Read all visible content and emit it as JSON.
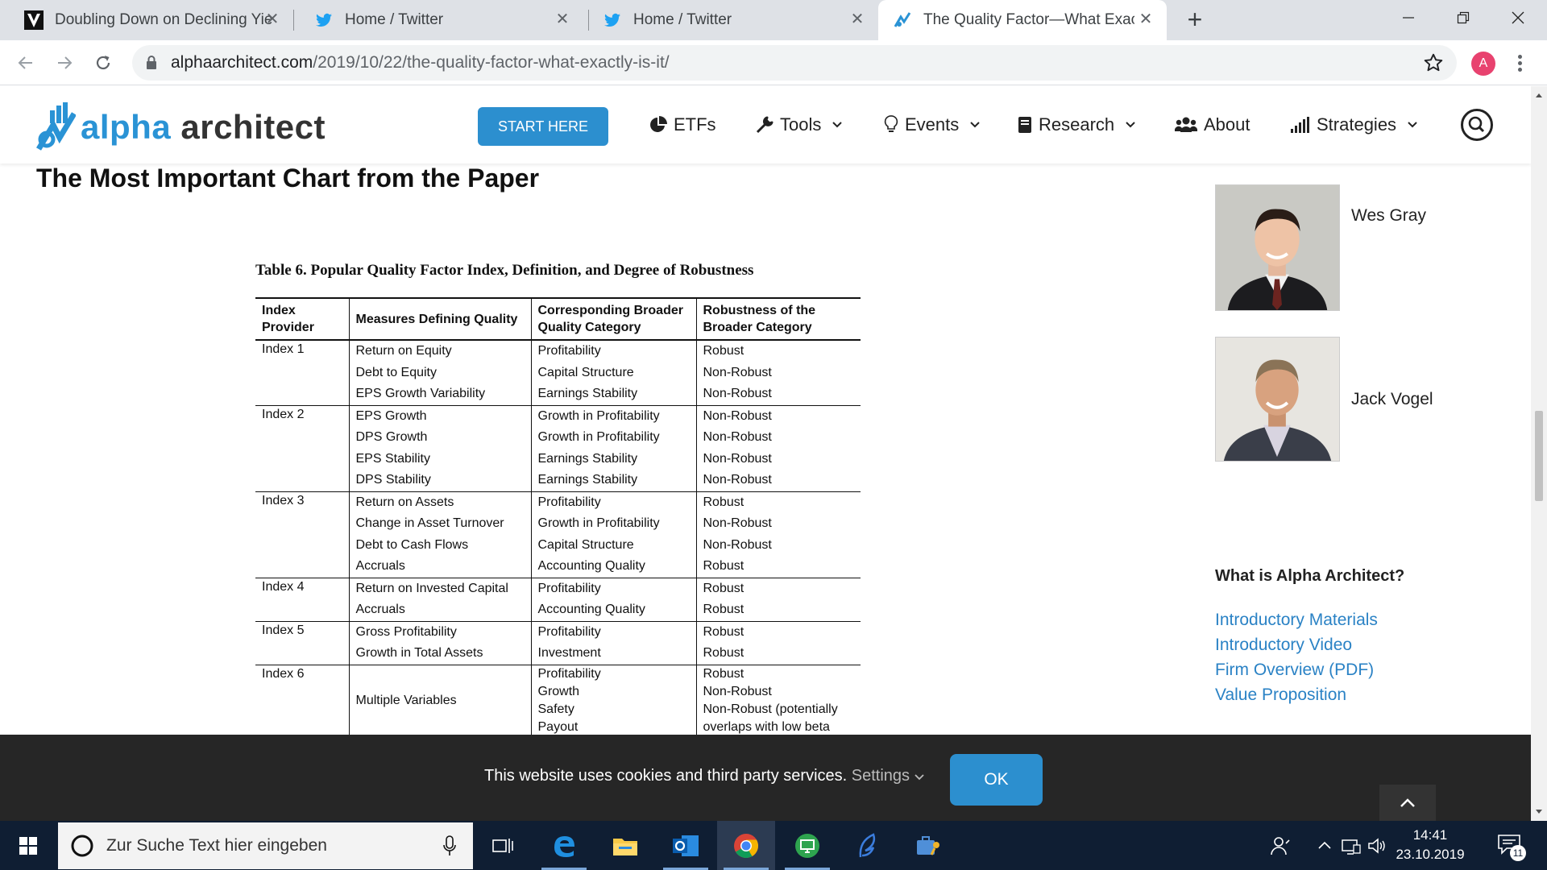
{
  "browser": {
    "tabs": [
      {
        "title": "Doubling Down on Declining Yiel",
        "favicon": "v-icon"
      },
      {
        "title": "Home / Twitter",
        "favicon": "twitter-icon"
      },
      {
        "title": "Home / Twitter",
        "favicon": "twitter-icon"
      },
      {
        "title": "The Quality Factor—What Exactly",
        "favicon": "alpha-architect-icon"
      }
    ],
    "url_host": "alphaarchitect.com",
    "url_path": "/2019/10/22/the-quality-factor-what-exactly-is-it/",
    "profile_initial": "A"
  },
  "site": {
    "logo_part1": "alpha",
    "logo_part2": "architect",
    "start_here": "START HERE",
    "nav": [
      {
        "label": "ETFs",
        "icon": "pie-chart-icon",
        "dropdown": false
      },
      {
        "label": "Tools",
        "icon": "wrench-icon",
        "dropdown": true
      },
      {
        "label": "Events",
        "icon": "lightbulb-icon",
        "dropdown": true
      },
      {
        "label": "Research",
        "icon": "book-icon",
        "dropdown": true
      },
      {
        "label": "About",
        "icon": "users-icon",
        "dropdown": false
      },
      {
        "label": "Strategies",
        "icon": "signal-bars-icon",
        "dropdown": true
      }
    ]
  },
  "article": {
    "heading": "The Most Important Chart from the Paper",
    "table": {
      "caption": "Table 6. Popular Quality Factor Index, Definition, and Degree of Robustness",
      "headers": [
        "Index Provider",
        "Measures Defining Quality",
        "Corresponding Broader Quality Category",
        "Robustness of the Broader Category"
      ],
      "groups": [
        {
          "index": "Index 1",
          "rows": [
            [
              "Return on Equity",
              "Profitability",
              "Robust"
            ],
            [
              "Debt to Equity",
              "Capital Structure",
              "Non-Robust"
            ],
            [
              "EPS Growth Variability",
              "Earnings Stability",
              "Non-Robust"
            ]
          ]
        },
        {
          "index": "Index 2",
          "rows": [
            [
              "EPS Growth",
              "Growth in Profitability",
              "Non-Robust"
            ],
            [
              "DPS Growth",
              "Growth in Profitability",
              "Non-Robust"
            ],
            [
              "EPS Stability",
              "Earnings Stability",
              "Non-Robust"
            ],
            [
              "DPS Stability",
              "Earnings Stability",
              "Non-Robust"
            ]
          ]
        },
        {
          "index": "Index 3",
          "rows": [
            [
              "Return on Assets",
              "Profitability",
              "Robust"
            ],
            [
              "Change in Asset Turnover",
              "Growth in Profitability",
              "Non-Robust"
            ],
            [
              "Debt to Cash Flows",
              "Capital Structure",
              "Non-Robust"
            ],
            [
              "Accruals",
              "Accounting Quality",
              "Robust"
            ]
          ]
        },
        {
          "index": "Index 4",
          "rows": [
            [
              "Return on Invested Capital",
              "Profitability",
              "Robust"
            ],
            [
              "Accruals",
              "Accounting Quality",
              "Robust"
            ]
          ]
        },
        {
          "index": "Index 5",
          "rows": [
            [
              "Gross Profitability",
              "Profitability",
              "Robust"
            ],
            [
              "Growth in Total Assets",
              "Investment",
              "Robust"
            ]
          ]
        }
      ],
      "index6": {
        "index": "Index 6",
        "measure": "Multiple Variables",
        "categories": [
          "Profitability",
          "Growth",
          "Safety",
          "Payout"
        ],
        "robustness": [
          "Robust",
          "Non-Robust",
          "Non-Robust (potentially",
          "overlaps with low beta"
        ]
      }
    }
  },
  "sidebar": {
    "authors": [
      "Wes Gray",
      "Jack Vogel"
    ],
    "section_title": "What is Alpha Architect?",
    "links": [
      "Introductory Materials",
      "Introductory Video",
      "Firm Overview (PDF)",
      "Value Proposition"
    ]
  },
  "cookie": {
    "text": "This website uses cookies and third party services.",
    "settings": "Settings",
    "ok": "OK"
  },
  "taskbar": {
    "search_placeholder": "Zur Suche Text hier eingeben",
    "time": "14:41",
    "date": "23.10.2019",
    "notification_count": "11"
  },
  "colors": {
    "accent": "#2c8fcf",
    "link": "#2a82c5",
    "taskbar": "#0f1e33",
    "cookie_bg": "#262626"
  }
}
